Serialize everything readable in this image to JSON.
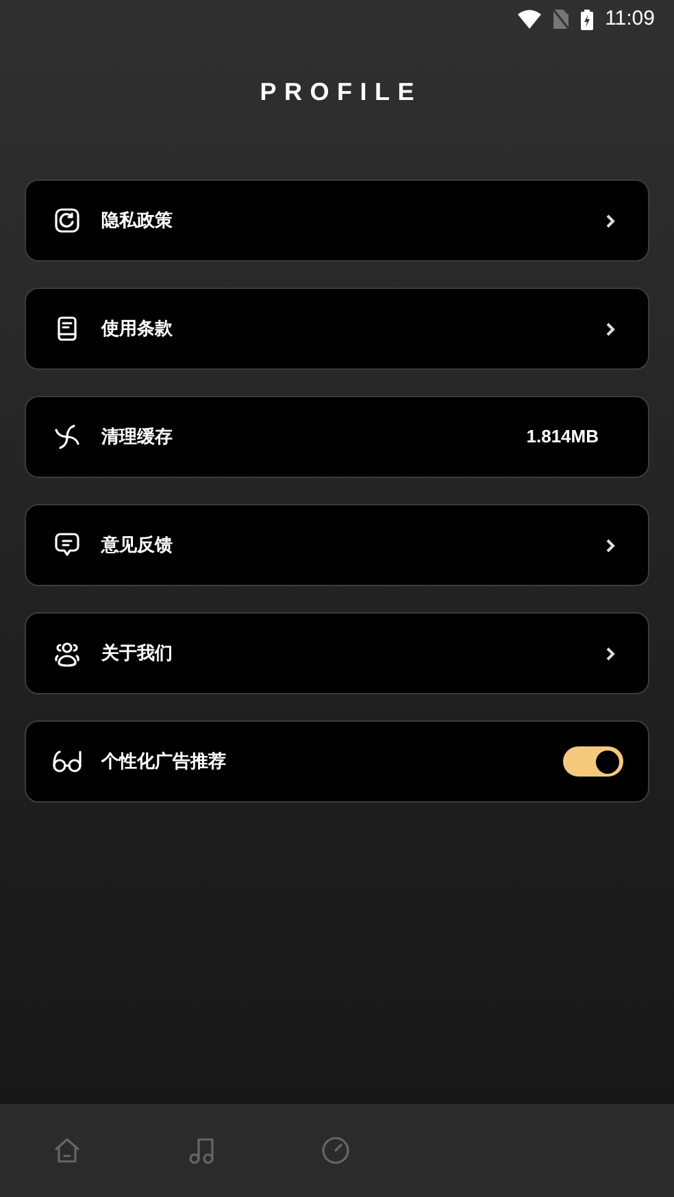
{
  "status_bar": {
    "time": "11:09"
  },
  "title": "PROFILE",
  "items": [
    {
      "kind": "link",
      "label": "隐私政策"
    },
    {
      "kind": "link",
      "label": "使用条款"
    },
    {
      "kind": "value",
      "label": "清理缓存",
      "value": "1.814MB"
    },
    {
      "kind": "link",
      "label": "意见反馈"
    },
    {
      "kind": "link",
      "label": "关于我们"
    },
    {
      "kind": "toggle",
      "label": "个性化广告推荐",
      "on": true
    }
  ],
  "bottom_nav": [
    {
      "selected": false
    },
    {
      "selected": false
    },
    {
      "selected": false
    }
  ]
}
